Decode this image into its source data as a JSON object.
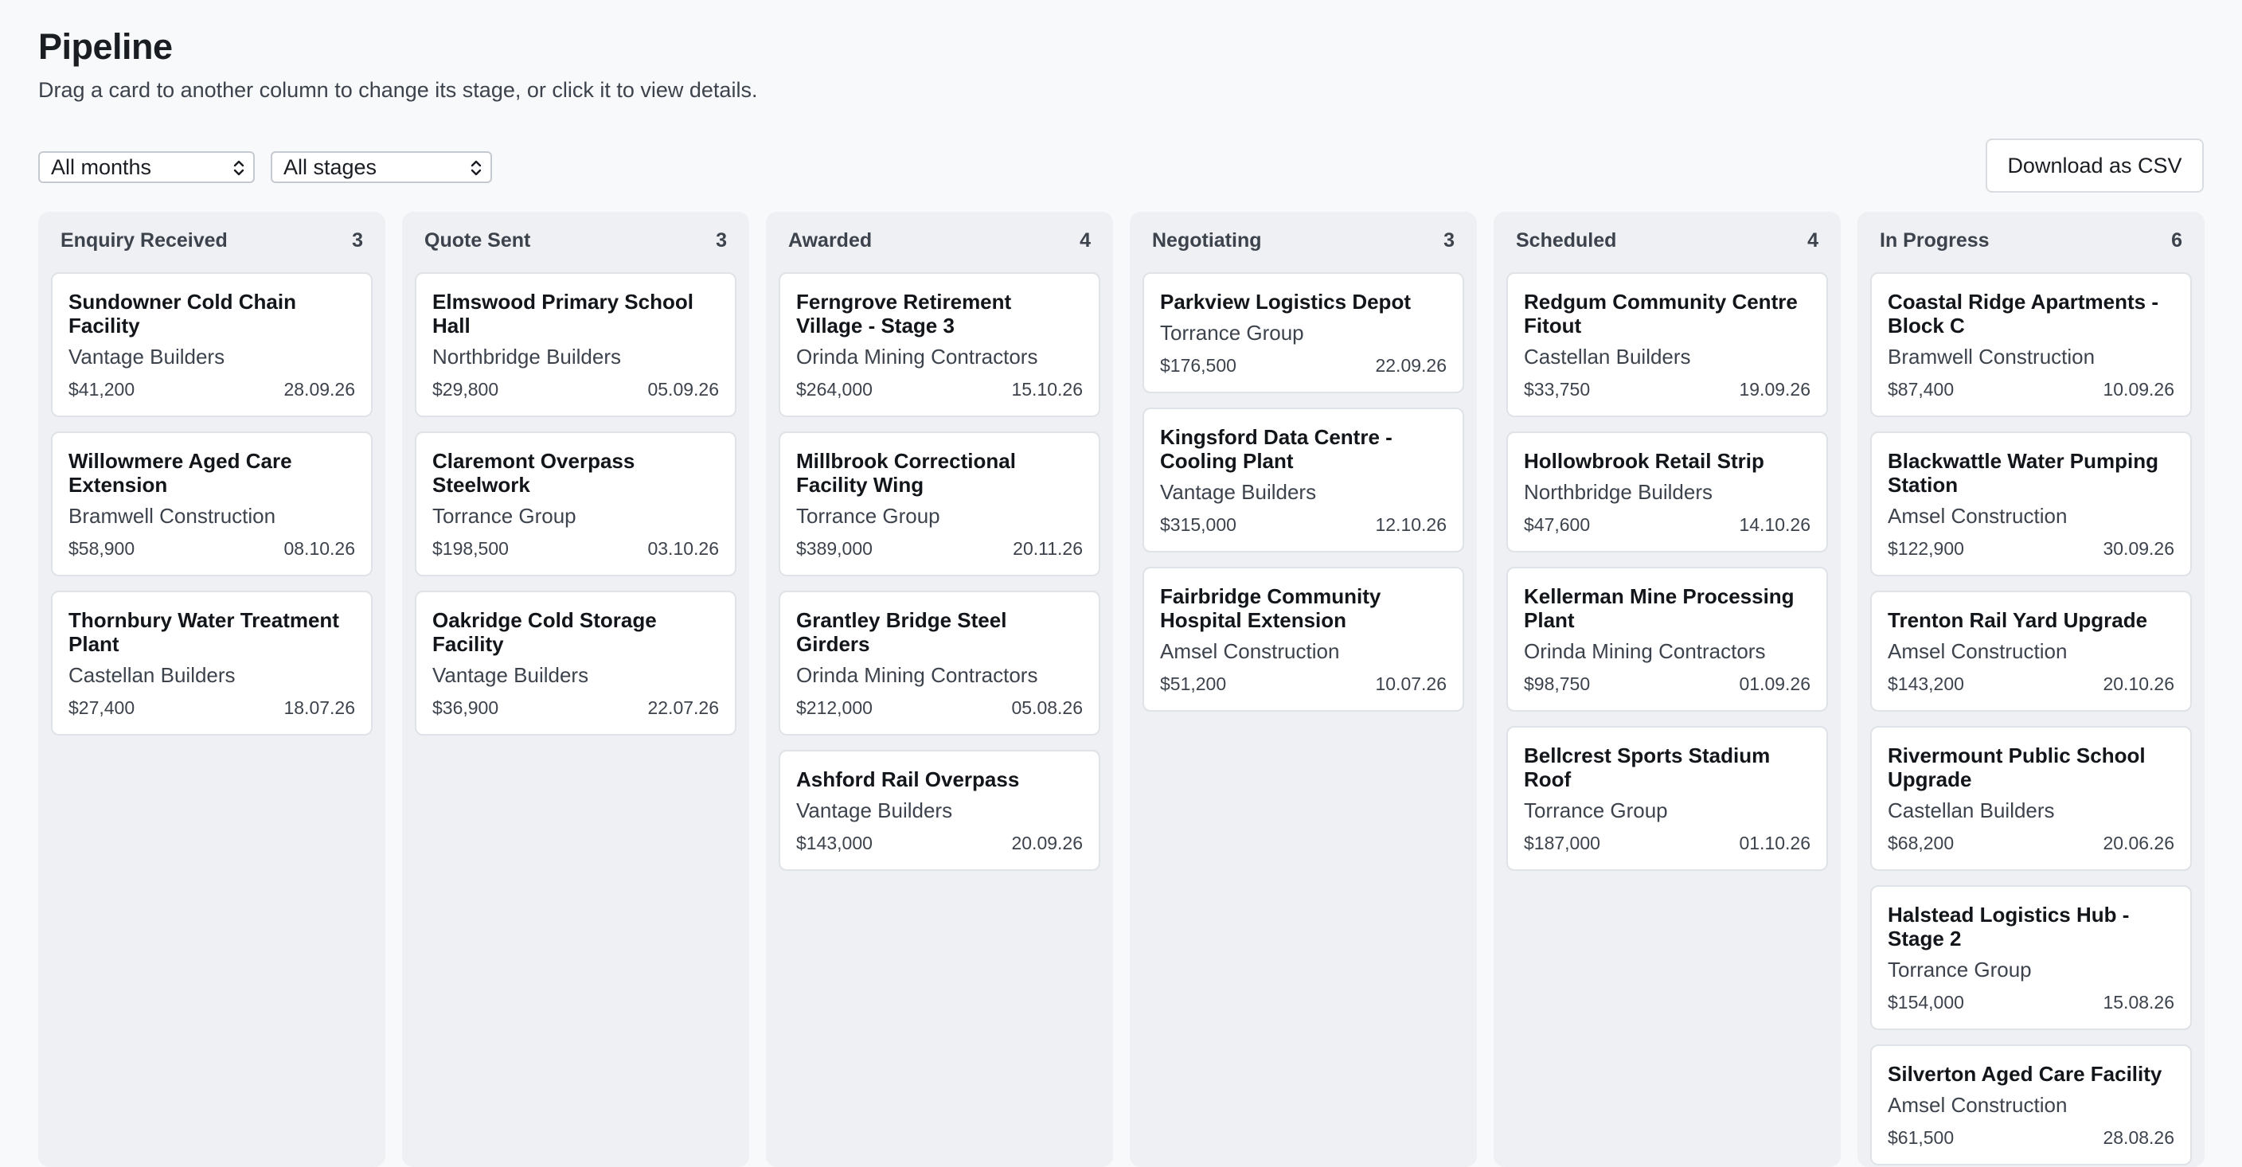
{
  "header": {
    "title": "Pipeline",
    "subtitle": "Drag a card to another column to change its stage, or click it to view details."
  },
  "filters": {
    "months": "All months",
    "stages": "All stages"
  },
  "toolbar": {
    "csv_label": "Download as CSV"
  },
  "columns": [
    {
      "name": "Enquiry Received",
      "count": "3",
      "cards": [
        {
          "title": "Sundowner Cold Chain Facility",
          "client": "Vantage Builders",
          "value": "$41,200",
          "date": "28.09.26"
        },
        {
          "title": "Willowmere Aged Care Extension",
          "client": "Bramwell Construction",
          "value": "$58,900",
          "date": "08.10.26"
        },
        {
          "title": "Thornbury Water Treatment Plant",
          "client": "Castellan Builders",
          "value": "$27,400",
          "date": "18.07.26"
        }
      ]
    },
    {
      "name": "Quote Sent",
      "count": "3",
      "cards": [
        {
          "title": "Elmswood Primary School Hall",
          "client": "Northbridge Builders",
          "value": "$29,800",
          "date": "05.09.26"
        },
        {
          "title": "Claremont Overpass Steelwork",
          "client": "Torrance Group",
          "value": "$198,500",
          "date": "03.10.26"
        },
        {
          "title": "Oakridge Cold Storage Facility",
          "client": "Vantage Builders",
          "value": "$36,900",
          "date": "22.07.26"
        }
      ]
    },
    {
      "name": "Awarded",
      "count": "4",
      "cards": [
        {
          "title": "Ferngrove Retirement Village - Stage 3",
          "client": "Orinda Mining Contractors",
          "value": "$264,000",
          "date": "15.10.26"
        },
        {
          "title": "Millbrook Correctional Facility Wing",
          "client": "Torrance Group",
          "value": "$389,000",
          "date": "20.11.26"
        },
        {
          "title": "Grantley Bridge Steel Girders",
          "client": "Orinda Mining Contractors",
          "value": "$212,000",
          "date": "05.08.26"
        },
        {
          "title": "Ashford Rail Overpass",
          "client": "Vantage Builders",
          "value": "$143,000",
          "date": "20.09.26"
        }
      ]
    },
    {
      "name": "Negotiating",
      "count": "3",
      "cards": [
        {
          "title": "Parkview Logistics Depot",
          "client": "Torrance Group",
          "value": "$176,500",
          "date": "22.09.26"
        },
        {
          "title": "Kingsford Data Centre - Cooling Plant",
          "client": "Vantage Builders",
          "value": "$315,000",
          "date": "12.10.26"
        },
        {
          "title": "Fairbridge Community Hospital Extension",
          "client": "Amsel Construction",
          "value": "$51,200",
          "date": "10.07.26"
        }
      ]
    },
    {
      "name": "Scheduled",
      "count": "4",
      "cards": [
        {
          "title": "Redgum Community Centre Fitout",
          "client": "Castellan Builders",
          "value": "$33,750",
          "date": "19.09.26"
        },
        {
          "title": "Hollowbrook Retail Strip",
          "client": "Northbridge Builders",
          "value": "$47,600",
          "date": "14.10.26"
        },
        {
          "title": "Kellerman Mine Processing Plant",
          "client": "Orinda Mining Contractors",
          "value": "$98,750",
          "date": "01.09.26"
        },
        {
          "title": "Bellcrest Sports Stadium Roof",
          "client": "Torrance Group",
          "value": "$187,000",
          "date": "01.10.26"
        }
      ]
    },
    {
      "name": "In Progress",
      "count": "6",
      "cards": [
        {
          "title": "Coastal Ridge Apartments - Block C",
          "client": "Bramwell Construction",
          "value": "$87,400",
          "date": "10.09.26"
        },
        {
          "title": "Blackwattle Water Pumping Station",
          "client": "Amsel Construction",
          "value": "$122,900",
          "date": "30.09.26"
        },
        {
          "title": "Trenton Rail Yard Upgrade",
          "client": "Amsel Construction",
          "value": "$143,200",
          "date": "20.10.26"
        },
        {
          "title": "Rivermount Public School Upgrade",
          "client": "Castellan Builders",
          "value": "$68,200",
          "date": "20.06.26"
        },
        {
          "title": "Halstead Logistics Hub - Stage 2",
          "client": "Torrance Group",
          "value": "$154,000",
          "date": "15.08.26"
        },
        {
          "title": "Silverton Aged Care Facility",
          "client": "Amsel Construction",
          "value": "$61,500",
          "date": "28.08.26"
        }
      ]
    }
  ]
}
